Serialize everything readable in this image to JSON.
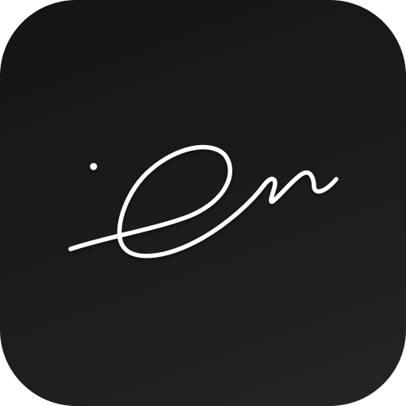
{
  "app_icon": {
    "icon_name": "signature-icon",
    "background_color": "#1a1a1a",
    "stroke_color": "#ffffff"
  }
}
